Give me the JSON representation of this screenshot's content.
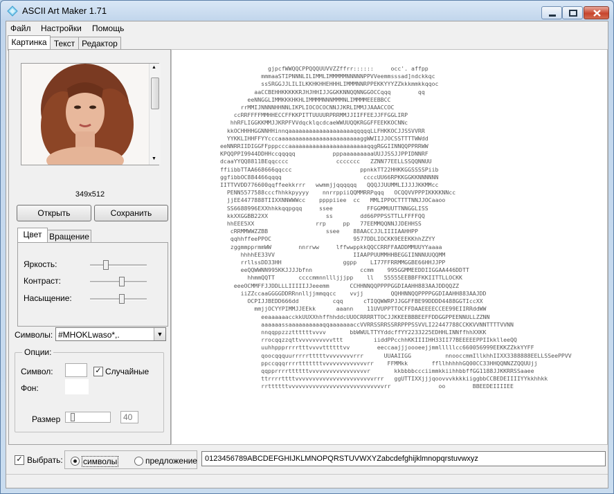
{
  "app": {
    "title": "ASCII Art Maker 1.71"
  },
  "menu": [
    {
      "label": "Файл"
    },
    {
      "label": "Настройки"
    },
    {
      "label": "Помощь"
    }
  ],
  "tabs": [
    {
      "label": "Картинка",
      "active": true
    },
    {
      "label": "Текст",
      "active": false
    },
    {
      "label": "Редактор",
      "active": false
    }
  ],
  "image_panel": {
    "size_label": "349x512",
    "open_label": "Открыть",
    "save_label": "Сохранить"
  },
  "inner_tabs": [
    {
      "label": "Цвет",
      "active": true
    },
    {
      "label": "Вращение",
      "active": false
    }
  ],
  "sliders": [
    {
      "label": "Яркость:",
      "value": 0.25
    },
    {
      "label": "Контраст:",
      "value": 0.55
    },
    {
      "label": "Насыщение:",
      "value": 0.55
    }
  ],
  "symbols": {
    "label": "Символы:",
    "value": "#MHOKLwaso*,."
  },
  "options": {
    "legend": "Опции:",
    "symbol_label": "Символ:",
    "symbol_value": "",
    "random_label": "Случайные",
    "random_checked": true,
    "background_label": "Фон:",
    "size_label": "Размер",
    "size_value": "40",
    "size_slider_value": 0.12
  },
  "bottom": {
    "select_label": "Выбрать:",
    "select_checked": true,
    "radio_symbols": "символы",
    "radio_sentence": "предложение",
    "selected_radio": "символы",
    "charset": "0123456789ABCDEFGHIJKLMNOPQRSTUVWXYZabcdefghijklmnopqrstuvwxyz"
  },
  "ascii_art": [
    "              gjpcfWWQQCPPQQQUUVVZZffrr::::::     occ'. affpp",
    "            mmmaaSTIPNNNLILIMMLIMMMMMNNNNNPPVVeemmsssad]ndckkqc",
    "            ssSRGGJJLILILKKHKHHEHHHLIMMMNNRPPEKKYYYZZkkkmmkkqqoc",
    "          aaCCBEHHKKKKKRJHJHHIJJGGKKNNQQNNGGOCCqqq        qq",
    "        eeNNGGLIMMKKKHKHLIMMMMNNNMMMNLIMMMMEEEBBCC",
    "      rrMMIJNNNNHHNNLIKPLIOCOCOCNNJJKRLIMMJJAAACCOC",
    "    ccRRFFFFMMHHECCFFKKPITTUUUURPRRMMJJIIFFEEJJFFGGLIRP",
    "   hhRFLIGGKKMMJJKRPFVVdqcklqcdcaeWWUUQQKRGGFFEEKKOCNNc",
    "  kkOCHHHHGGNNHHinnqaaaaaaaaaaaaaaaaaaaqqqqqLLFHKKOCJJSSVVRR",
    "  YYKKLIHHFFYYcccaaaaaaaaaaaaaaaaaaaaaaaaggWWIIJJOCSSTTTTWWdd",
    "eeNNRRIIDIGGFFpppcccaaaaaaaaaaaaaaaaaaaaaaaqqgRGGIINNQQPPRRWW",
    "KPQQPPI9944DDHHccqqqqq           pppaaaaaaaaaUUJJSSJJPPIDNNRF",
    "dcaaYYQQ8811BEqqcccc              ccccccc   ZZNN77EELLSSQQNNUU",
    "ffiibbTTAA668666qqccc                    ppnkkTT22HHKKGGSSSSPiib",
    "ggfibbOC884466qqqq                        ccccUU66RPKKGGKKNNNNNN",
    "IITTVVDD776600qqffeekkrrr   wwmmjjqqqqqq   QQQJJUUMMLIJJJJKKMMcc",
    "  PENN5577588cccfhhkkpyyyy    nnrrppiiQQMMRRPqqq   OCQQVVPPPIKKKKNNcc",
    "  jjEE4477888TIIXXNNWWWcc    ppppiiee  cc   MMLIPPOCTTTTNNJJOCaaoo",
    "  SS6688996EXXhhkkqqpgqq     ssee          FFGGMMUUTTNNGGLISS",
    "  kkXXGGBB22XX                 ss        dd66PPPSSTTLLFFFFQQ",
    "  hhEEE5XX                  rrp     pp   77EEMMQQNNJJDEHHSS",
    "   cRRMMWWZZBB                 ssee    88AACCJJLIIIIAAHHPP",
    "   qqhhffeePPOC                        9577DDLIOCKK9EEEKKhhZZYY",
    "   zggmmpprmmWW        nnrrww     lffwwppkkQQCCRRFFAADDMMUUYYaaaa",
    "      hhhhEE33VV                       IIAAPPUUMMHHBEGGIINNNUUQQMM",
    "      rrllssDD33HH                  ggpp    LI77FFRRMMGGBE66HHJJPP",
    "      eeQQWWNN995KKJJJJbfnn              ccmm    995GGMMEEDDIIGGAA446DDTT",
    "        hhmmQQTT       ccccmmnnllljjjpp    ll   55555EEBBFFKKIITTLLOCKK",
    "    eeeOCMMFFJJDDLLLIIIIIJJeeemm      CCHHNNQQPPPPGGDIAAHH883AAJDDQQZZ",
    "      iiZZccaaGGGGDDRRnnlljjmmqqcc    vvjj        QQHHNNQQPPPPGGDIAAHH883AAJDD",
    "        OCPIJJBEDD666dd          cqq      cTIQQWWRPJJGGFFBE99DDDD4488GGTIccXX",
    "          mmjjOCYYPIMMJJEEkk      aaann    11UVUPPTTOCFFDAAEEEECCEE99EIIRRddWW",
    "            eeaaaaaacckkUUXXhhffhhddcUUOCRRRRTTOCJJKKEEBBBEEFFDDGGPPEENNULLZZNN",
    "            aaaaaassaaaaaaaaaaqqaaaaaaaccVVRRSSRRSSRRPPPSSVVLI22447788CCKKVVNNTTTTVVNN",
    "            nnqqppzzzttttttvvvv       bbWWULTTYYddcffYY2233225EDHHLINNffhhXXKK",
    "            rrocqqzzqttvvvvvvvvvvttt         iiddPPcchhKKIIIIHH33II77BEEEEEPPIIkklleeQQ",
    "            uuhhppprrrrtttvvvvttttttvv        eeccaajjjoooeejjmmlllllcc660056999EEKKZZkkYYFF",
    "            qoocqqquurrrrrtttttvvvvvvvvrrr      UUAAIIGG          nnooccmmIllkhhIIXX3388888EELLSSeePPVV",
    "            ppccqqqrrrrtttttttvvvvvvvvvvvvvrr    FFMMkk       ffllhhhhhGQ00CC33HHQQNNZZQQUUjj",
    "            qqpprrrrttttttvvvvvvvvvvvvvvvvvr       kkbbbbccciimmkkiihhbbffGG1188JJKKRRSSaaee",
    "            ttrrrrttttvvvvvvvvvvvvvvvvvvvvvvvrrr   ggUTTIXXjjjqoovvvkkkkiiggbbCCBEDEIIIIYYkkhhkk",
    "            rrttttttvvvvvvvvvvvvvvvvvvvvvvvvvvvvrr              oo        BBEEDEIIIIEE"
  ]
}
